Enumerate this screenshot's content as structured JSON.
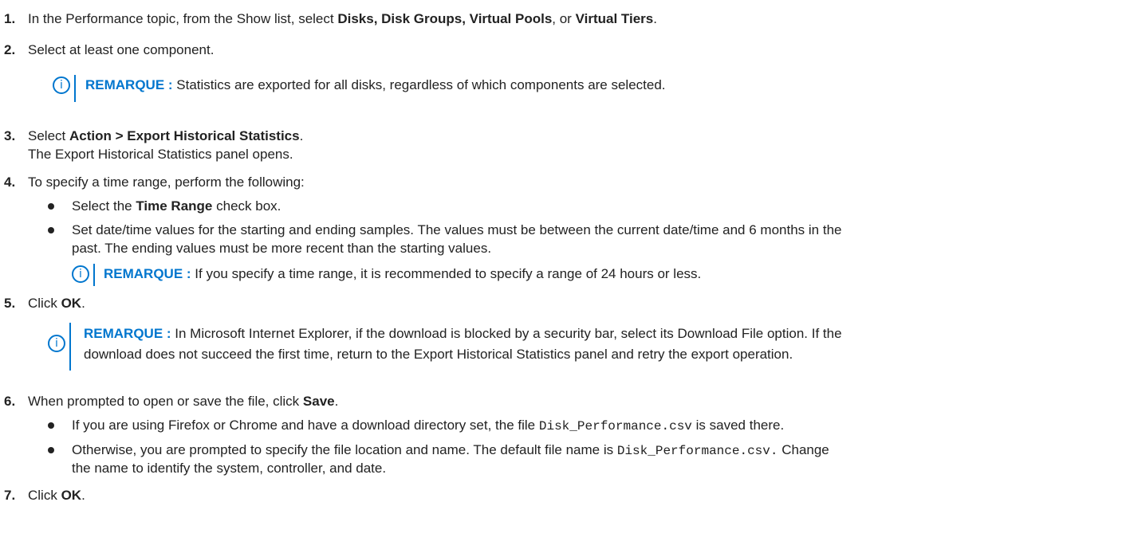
{
  "steps": [
    {
      "num": "1.",
      "parts": [
        "In the Performance topic, from the Show list, select ",
        "Disks, Disk Groups, Virtual Pools",
        ", or ",
        "Virtual Tiers",
        "."
      ]
    },
    {
      "num": "2.",
      "text": "Select at least one component."
    },
    {
      "num": "3.",
      "parts": [
        "Select ",
        "Action > Export Historical Statistics",
        "."
      ],
      "detail": "The Export Historical Statistics panel opens."
    },
    {
      "num": "4.",
      "text": "To specify a time range, perform the following:",
      "bullets": [
        {
          "parts": [
            "Select the ",
            "Time Range",
            " check box."
          ]
        },
        {
          "line1": "Set date/time values for the starting and ending samples. The values must be between the current date/time and 6 months in the",
          "line2": "past. The ending values must be more recent than the starting values."
        }
      ]
    },
    {
      "num": "5.",
      "parts": [
        "Click ",
        "OK",
        "."
      ]
    },
    {
      "num": "6.",
      "parts": [
        "When prompted to open or save the file, click ",
        "Save",
        "."
      ],
      "bullets": [
        {
          "parts": [
            "If you are using Firefox or Chrome and have a download directory set, the file ",
            "Disk_Performance.csv",
            " is saved there."
          ]
        },
        {
          "parts": [
            "Otherwise, you are prompted to specify the file location and name. The default file name is ",
            "Disk_Performance.csv.",
            " Change"
          ],
          "line2": "the name to identify the system, controller, and date."
        }
      ]
    },
    {
      "num": "7.",
      "parts": [
        "Click ",
        "OK",
        "."
      ]
    }
  ],
  "notes": [
    {
      "label": "REMARQUE :",
      "text": " Statistics are exported for all disks, regardless of which components are selected."
    },
    {
      "label": "REMARQUE :",
      "text": " If you specify a time range, it is recommended to specify a range of 24 hours or less."
    },
    {
      "label": "REMARQUE :",
      "text": " In Microsoft Internet Explorer, if the download is blocked by a security bar, select its Download File option. If the",
      "line2": "download does not succeed the first time, return to the Export Historical Statistics panel and retry the export operation."
    }
  ],
  "note_icon_glyph": "i",
  "accent_color": "#0076ce"
}
